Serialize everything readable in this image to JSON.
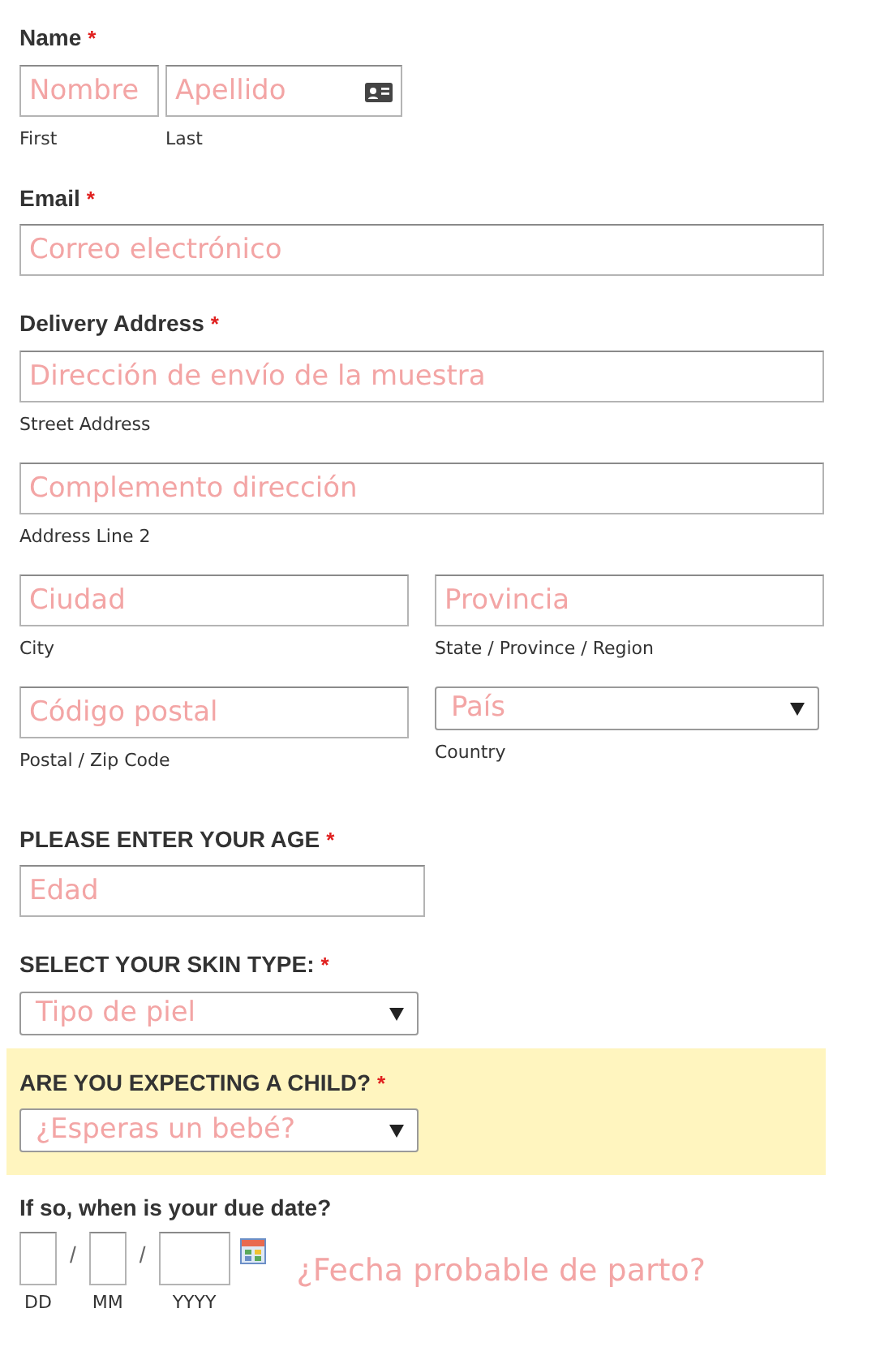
{
  "name": {
    "label": "Name",
    "required_mark": "*",
    "first": {
      "placeholder": "Nombre",
      "sublabel": "First"
    },
    "last": {
      "placeholder": "Apellido",
      "sublabel": "Last"
    }
  },
  "email": {
    "label": "Email",
    "required_mark": "*",
    "placeholder": "Correo electrónico"
  },
  "address": {
    "label": "Delivery Address",
    "required_mark": "*",
    "street": {
      "placeholder": "Dirección de envío de la muestra",
      "sublabel": "Street Address"
    },
    "line2": {
      "placeholder": "Complemento dirección",
      "sublabel": "Address Line 2"
    },
    "city": {
      "placeholder": "Ciudad",
      "sublabel": "City"
    },
    "state": {
      "placeholder": "Provincia",
      "sublabel": "State / Province / Region"
    },
    "postal": {
      "placeholder": "Código postal",
      "sublabel": "Postal / Zip Code"
    },
    "country": {
      "placeholder": "País",
      "sublabel": "Country"
    }
  },
  "age": {
    "label": "PLEASE ENTER YOUR AGE",
    "required_mark": "*",
    "placeholder": "Edad",
    "highlighted": false
  },
  "skin": {
    "label": "SELECT YOUR SKIN TYPE:",
    "required_mark": "*",
    "placeholder": "Tipo de piel",
    "highlighted": false
  },
  "child": {
    "label": "ARE YOU EXPECTING A CHILD?",
    "required_mark": "*",
    "placeholder": "¿Esperas un bebé?",
    "highlighted": true
  },
  "due": {
    "label": "If so, when is your due date?",
    "separators": [
      "/",
      "/"
    ],
    "parts": [
      "DD",
      "MM",
      "YYYY"
    ],
    "hint": "¿Fecha probable de parto?"
  }
}
